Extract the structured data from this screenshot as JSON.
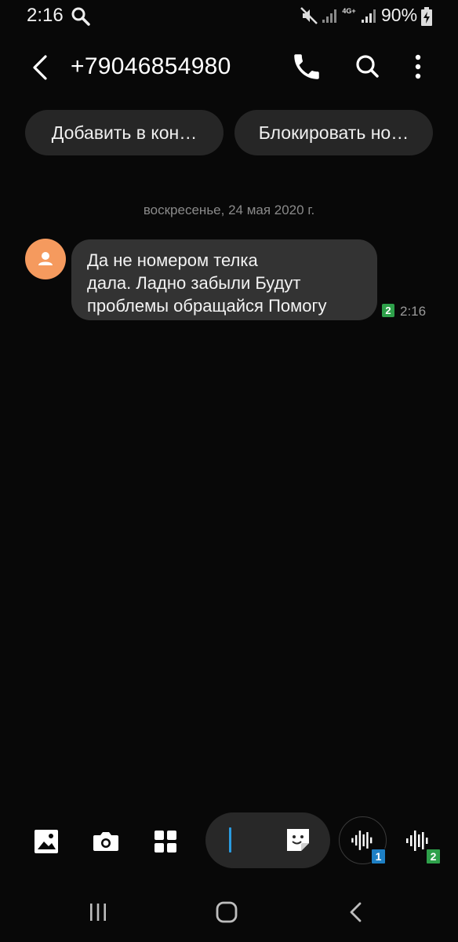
{
  "status_bar": {
    "time": "2:16",
    "network": "4G+",
    "battery": "90%",
    "icons": [
      "search-icon",
      "mute-icon",
      "signal-icon",
      "signal-icon",
      "battery-charging-icon"
    ]
  },
  "header": {
    "contact": "+79046854980",
    "icons": [
      "back-icon",
      "phone-icon",
      "search-icon",
      "more-vertical-icon"
    ]
  },
  "actions": {
    "add_contact": "Добавить в кон…",
    "block_number": "Блокировать но…"
  },
  "conversation": {
    "date": "воскресенье, 24 мая 2020 г.",
    "messages": [
      {
        "lines": [
          "Да не номером телка",
          "дала. Ладно забыли Будут",
          "проблемы обращайся Помогу"
        ],
        "sim": "2",
        "time": "2:16"
      }
    ]
  },
  "composer": {
    "icons": [
      "gallery-icon",
      "camera-icon",
      "apps-icon",
      "sticker-icon",
      "voice-wave-icon"
    ],
    "sim1_label": "1",
    "sim2_label": "2",
    "accent": "#2a9be0"
  },
  "colors": {
    "background": "#080808",
    "bubble": "#333333",
    "avatar": "#f59a5e",
    "sim1": "#1d7fc4",
    "sim2": "#2ea04a"
  }
}
